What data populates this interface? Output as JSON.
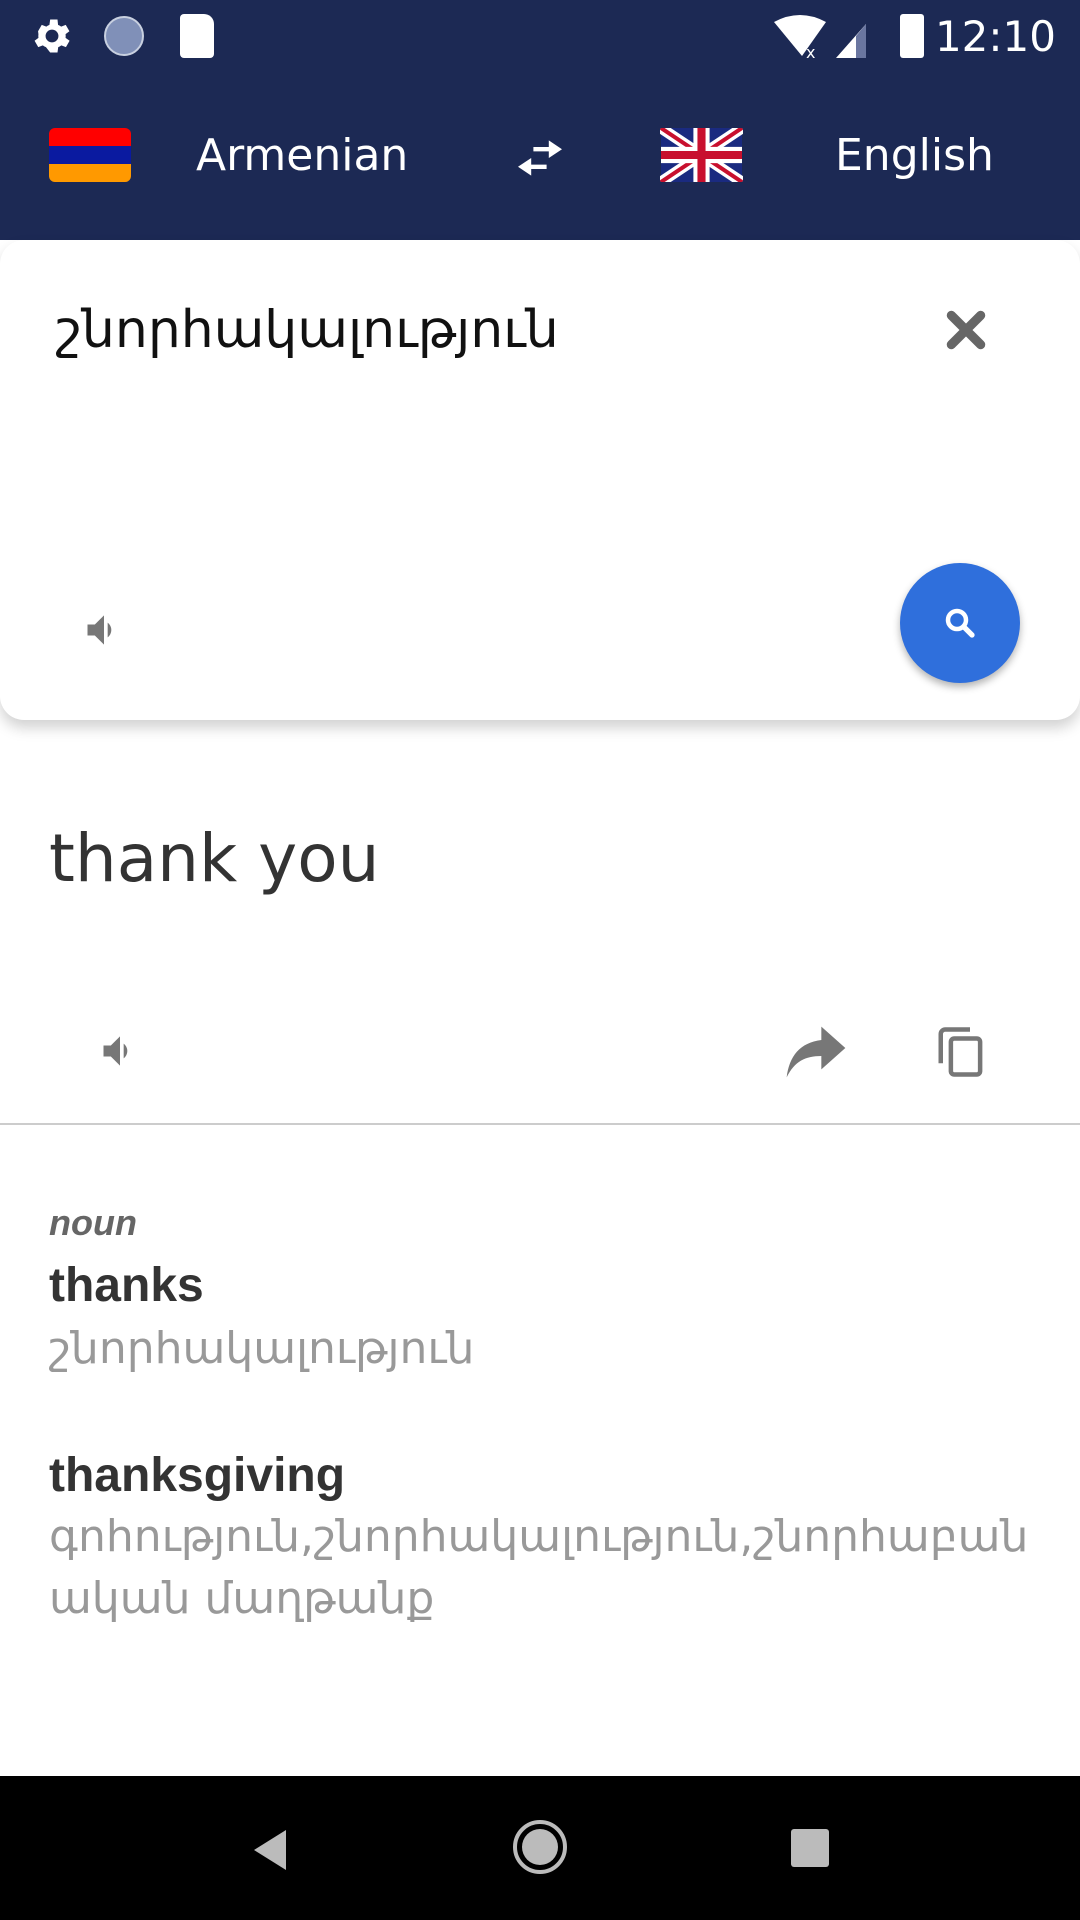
{
  "status_bar": {
    "time": "12:10",
    "icons": [
      "settings-icon",
      "sync-icon",
      "sd-card-icon",
      "wifi-off-icon",
      "signal-icon",
      "battery-icon"
    ]
  },
  "header": {
    "source_language": "Armenian",
    "target_language": "English",
    "swap_icon": "swap-icon"
  },
  "input": {
    "text": "շնորհակալություն"
  },
  "result": {
    "translation": "thank you"
  },
  "dictionary": {
    "part_of_speech": "noun",
    "entries": [
      {
        "word": "thanks",
        "translations": "շնորհակալություն"
      },
      {
        "word": "thanksgiving",
        "translations": "գոհություն,շնորհակալություն,շնորհաբանական մաղթանք"
      }
    ]
  },
  "colors": {
    "header": "#1c2954",
    "accent": "#2f6fdc"
  }
}
